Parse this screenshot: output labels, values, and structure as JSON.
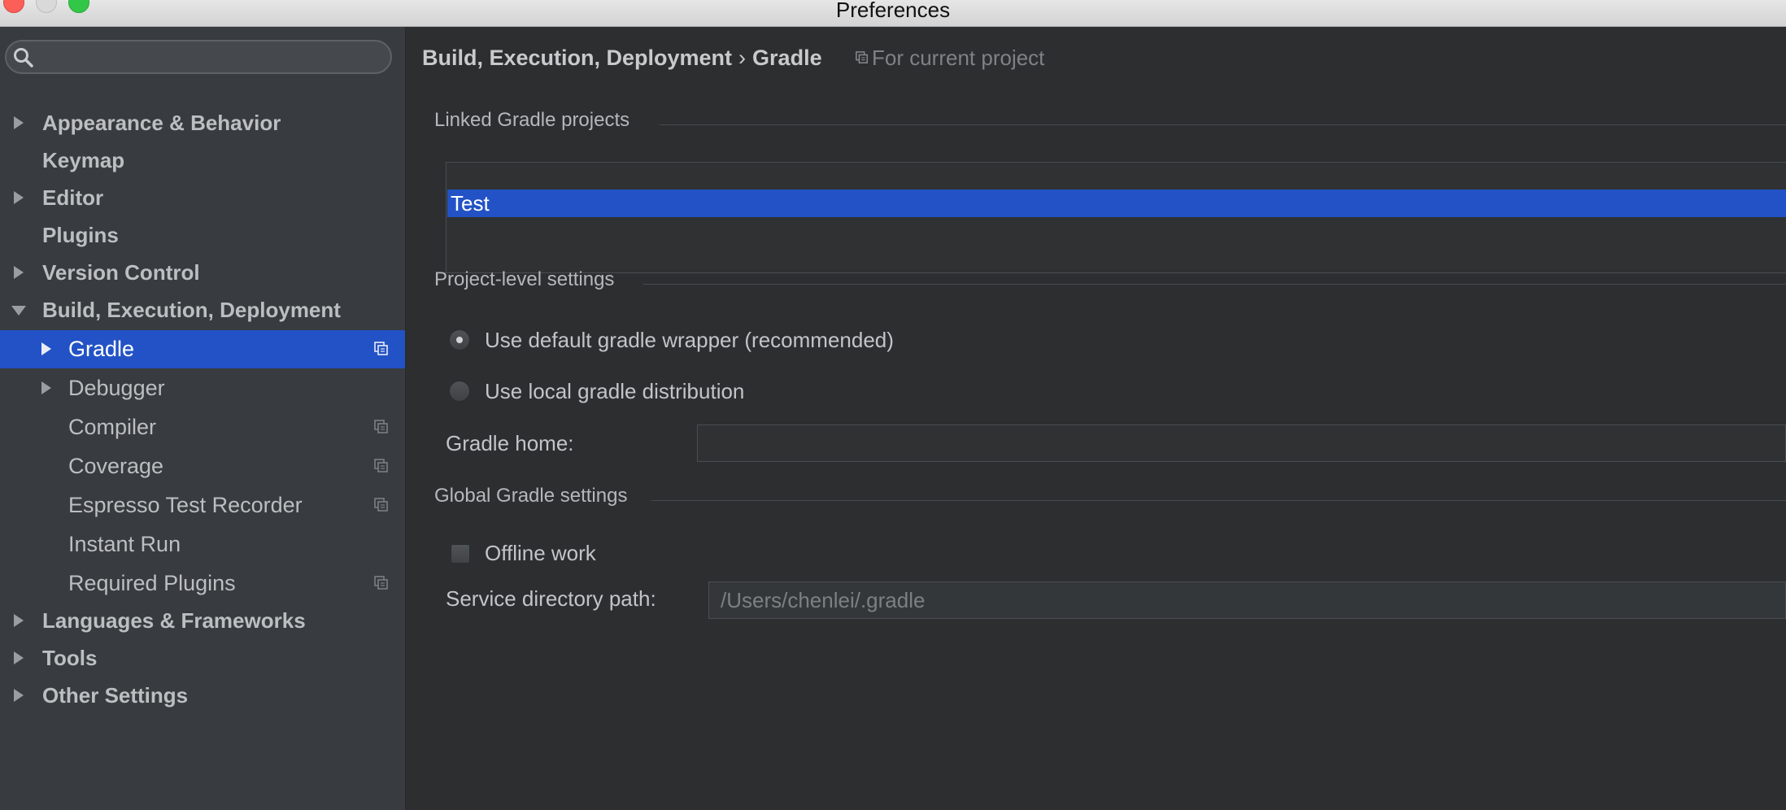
{
  "window": {
    "title": "Preferences"
  },
  "search": {
    "placeholder": "",
    "value": ""
  },
  "sidebar": {
    "items": [
      {
        "label": "Appearance & Behavior",
        "expandable": true,
        "expanded": false
      },
      {
        "label": "Keymap",
        "expandable": false
      },
      {
        "label": "Editor",
        "expandable": true,
        "expanded": false
      },
      {
        "label": "Plugins",
        "expandable": false
      },
      {
        "label": "Version Control",
        "expandable": true,
        "expanded": false
      },
      {
        "label": "Build, Execution, Deployment",
        "expandable": true,
        "expanded": true
      },
      {
        "label": "Gradle",
        "expandable": true,
        "selected": true,
        "project_icon": true
      },
      {
        "label": "Debugger",
        "expandable": true
      },
      {
        "label": "Compiler",
        "project_icon": true
      },
      {
        "label": "Coverage",
        "project_icon": true
      },
      {
        "label": "Espresso Test Recorder",
        "project_icon": true
      },
      {
        "label": "Instant Run"
      },
      {
        "label": "Required Plugins",
        "project_icon": true
      },
      {
        "label": "Languages & Frameworks",
        "expandable": true,
        "expanded": false
      },
      {
        "label": "Tools",
        "expandable": true,
        "expanded": false
      },
      {
        "label": "Other Settings",
        "expandable": true,
        "expanded": false
      }
    ]
  },
  "breadcrumb": {
    "parent": "Build, Execution, Deployment",
    "separator": "›",
    "current": "Gradle",
    "scope_label": "For current project"
  },
  "linked_projects": {
    "title": "Linked Gradle projects",
    "items": [
      "Test"
    ],
    "selected": "Test"
  },
  "project_settings": {
    "title": "Project-level settings",
    "option_wrapper": "Use default gradle wrapper (recommended)",
    "option_local": "Use local gradle distribution",
    "selected_option": "Use default gradle wrapper (recommended)",
    "gradle_home_label": "Gradle home:",
    "gradle_home_value": ""
  },
  "global_settings": {
    "title": "Global Gradle settings",
    "offline_label": "Offline work",
    "offline_checked": false,
    "service_dir_label": "Service directory path:",
    "service_dir_value": "/Users/chenlei/.gradle"
  },
  "colors": {
    "selection": "#2252c5",
    "sidebar_bg": "#383b3f",
    "content_bg": "#2d2e30"
  }
}
